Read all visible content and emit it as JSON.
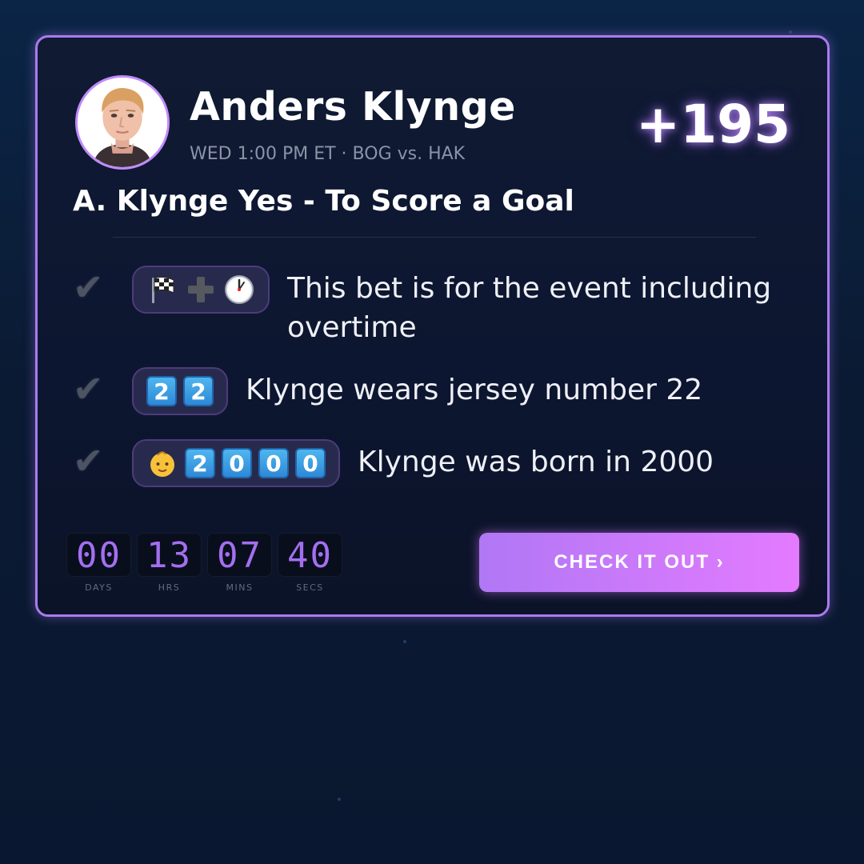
{
  "card": {
    "player_name": "Anders Klynge",
    "event_line": "WED 1:00 PM ET · BOG vs. HAK",
    "odds": "+195",
    "bet_title": "A. Klynge Yes - To Score a Goal"
  },
  "facts": [
    {
      "check": "✔",
      "badge_icons": [
        "chequered-flag-icon",
        "plus-icon",
        "clock-icon"
      ],
      "text": "This bet is for the event including overtime"
    },
    {
      "check": "✔",
      "badge_tiles": [
        "2",
        "2"
      ],
      "text": "Klynge wears jersey number 22"
    },
    {
      "check": "✔",
      "badge_icons": [
        "baby-face-icon"
      ],
      "badge_tiles": [
        "2",
        "0",
        "0",
        "0"
      ],
      "text": "Klynge was born in 2000"
    }
  ],
  "countdown": {
    "days": "00",
    "hours": "13",
    "mins": "07",
    "secs": "40",
    "labels": {
      "days": "DAYS",
      "hours": "HRS",
      "mins": "MINS",
      "secs": "SECS"
    }
  },
  "cta": {
    "label": "CHECK IT OUT ›"
  },
  "colors": {
    "accent": "#a97bf0",
    "cta_gradient_start": "#b078f5",
    "cta_gradient_end": "#e47aff",
    "countdown_digits": "#a36ff0",
    "tile": "#2e88d6"
  }
}
